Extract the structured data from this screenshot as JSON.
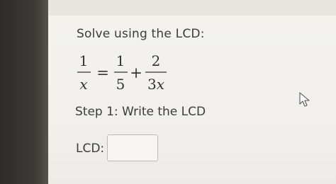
{
  "problem": {
    "instruction": "Solve using the LCD:",
    "equation": {
      "lhs": {
        "numerator": "1",
        "denominator": "x"
      },
      "equals": "=",
      "term1": {
        "numerator": "1",
        "denominator": "5"
      },
      "plus": "+",
      "term2": {
        "numerator": "2",
        "denominator_coef": "3",
        "denominator_var": "x"
      }
    }
  },
  "step": {
    "label": "Step 1: Write the LCD"
  },
  "answer": {
    "label": "LCD:",
    "value": "",
    "placeholder": ""
  },
  "icons": {
    "cursor": "mouse-pointer-icon"
  }
}
